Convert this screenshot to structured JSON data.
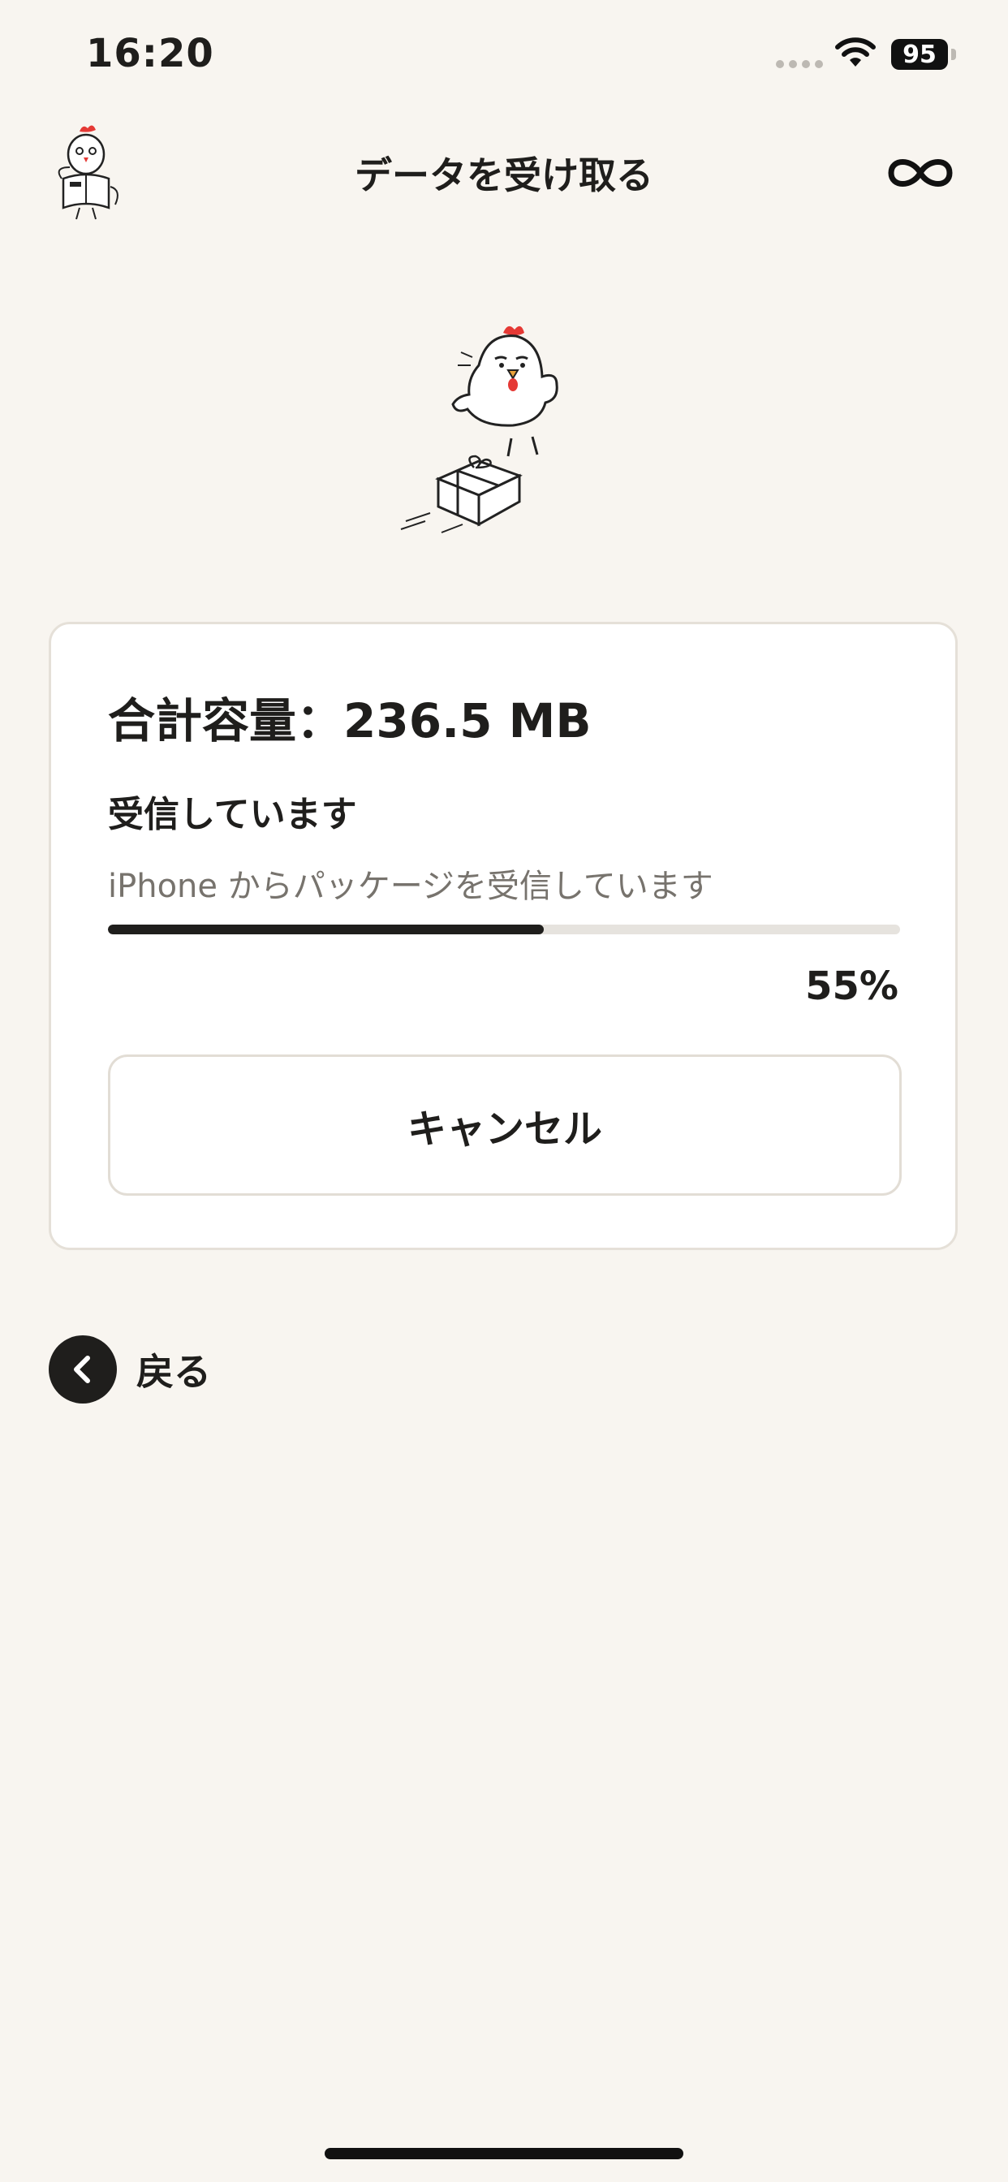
{
  "status_bar": {
    "time": "16:20",
    "battery": "95"
  },
  "header": {
    "title": "データを受け取る"
  },
  "card": {
    "total_size": "合計容量：236.5 MB",
    "status_heading": "受信しています",
    "status_detail": "iPhone からパッケージを受信しています",
    "progress_percent_text": "55%",
    "progress_fraction": 0.55,
    "cancel_label": "キャンセル"
  },
  "back": {
    "label": "戻る"
  },
  "icons": {
    "avatar": "chicken-reading-icon",
    "hero": "chicken-with-package-icon",
    "infinity": "infinity-icon",
    "back": "chevron-left-icon"
  },
  "colors": {
    "background": "#f8f5f0",
    "accent": "#1f1e1c",
    "comb": "#e53935"
  }
}
